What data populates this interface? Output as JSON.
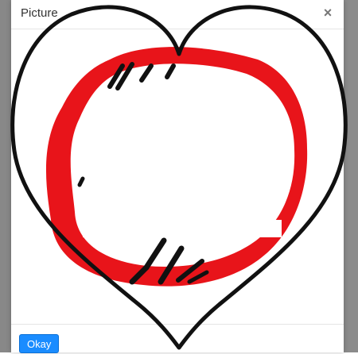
{
  "dialog": {
    "title": "Picture",
    "close_glyph": "×",
    "ok_label": "Okay"
  },
  "colors": {
    "accent_button": "#1a8cff",
    "ring_red": "#e8141a",
    "stroke_black": "#111111",
    "backdrop": "#7a7a7a"
  },
  "icons": {
    "close": "close-icon",
    "overlay": "heart-outline-icon"
  }
}
